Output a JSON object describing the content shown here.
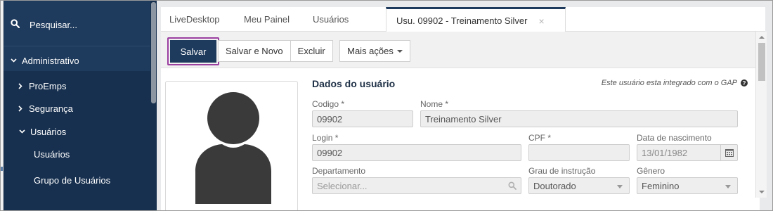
{
  "sidebar": {
    "search_label": "Pesquisar...",
    "items": [
      {
        "label": "Administrativo",
        "chevron": "down"
      },
      {
        "label": "ProEmps",
        "chevron": "right"
      },
      {
        "label": "Segurança",
        "chevron": "right"
      },
      {
        "label": "Usuários",
        "chevron": "down"
      },
      {
        "label": "Usuários"
      },
      {
        "label": "Grupo de Usuários"
      }
    ]
  },
  "tabs": [
    {
      "label": "LiveDesktop"
    },
    {
      "label": "Meu Painel"
    },
    {
      "label": "Usuários"
    },
    {
      "label": "Usu. 09902 - Treinamento Silver",
      "active": true,
      "close": "×"
    }
  ],
  "toolbar": {
    "save_label": "Salvar",
    "save_new_label": "Salvar e Novo",
    "delete_label": "Excluir",
    "more_actions_label": "Mais ações"
  },
  "form": {
    "section_title": "Dados do usuário",
    "integration_note": "Este usuário esta integrado com o GAP",
    "help_icon_glyph": "?",
    "fields": {
      "codigo": {
        "label": "Codigo *",
        "value": "09902"
      },
      "nome": {
        "label": "Nome *",
        "value": "Treinamento Silver"
      },
      "login": {
        "label": "Login *",
        "value": "09902"
      },
      "cpf": {
        "label": "CPF *",
        "value": ""
      },
      "nascimento": {
        "label": "Data de nascimento",
        "value": "13/01/1982"
      },
      "departamento": {
        "label": "Departamento",
        "placeholder": "Selecionar..."
      },
      "grau": {
        "label": "Grau de instrução",
        "value": "Doutorado"
      },
      "genero": {
        "label": "Gênero",
        "value": "Feminino"
      }
    }
  },
  "colors": {
    "sidebar_bg": "#1e3a5c",
    "save_button_bg": "#1e3a5c",
    "highlight_outline": "#9b3fa0"
  },
  "icons": [
    "search-icon",
    "chevron-down-icon",
    "chevron-right-icon",
    "close-icon",
    "help-icon",
    "calendar-icon",
    "caret-down-icon",
    "user-avatar-icon"
  ]
}
